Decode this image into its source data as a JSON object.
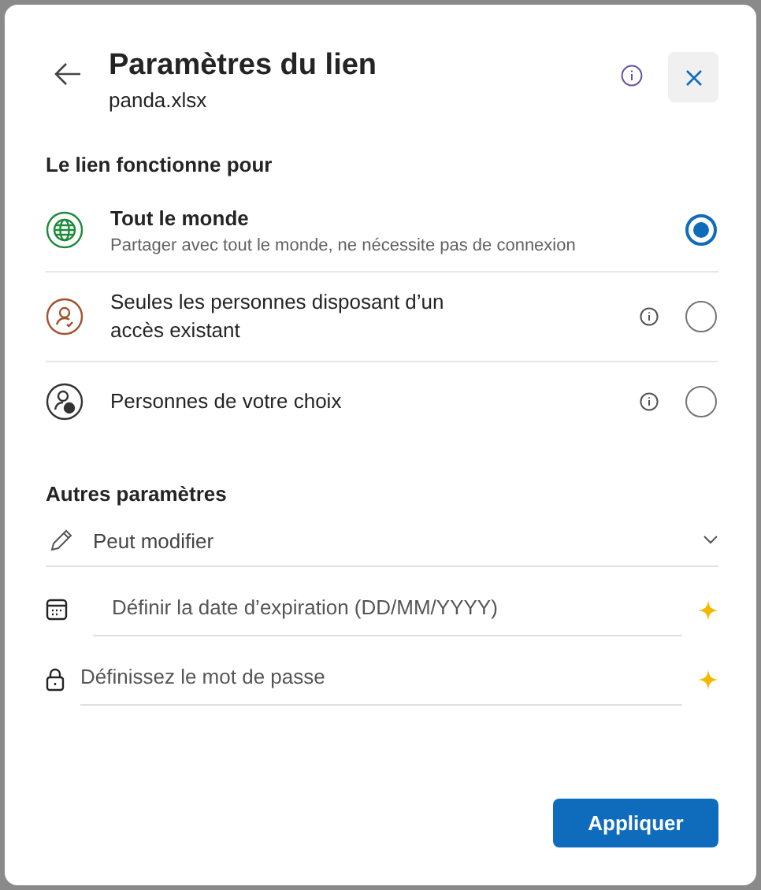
{
  "dialog": {
    "title": "Paramètres du lien",
    "subtitle": "panda.xlsx"
  },
  "section_title": "Le lien fonctionne pour",
  "options": [
    {
      "label": "Tout le monde",
      "description": "Partager avec tout le monde, ne nécessite pas de connexion",
      "info": false,
      "selected": true
    },
    {
      "label": "Seules les personnes disposant d’un accès existant",
      "info": true,
      "selected": false
    },
    {
      "label": "Personnes de votre choix",
      "info": true,
      "selected": false
    }
  ],
  "other_title": "Autres paramètres",
  "settings": [
    {
      "kind": "dropdown",
      "value": "Peut modifier"
    },
    {
      "kind": "date",
      "placeholder": "Définir la date d’expiration (DD/MM/YYYY)"
    },
    {
      "kind": "password",
      "placeholder": "Définissez le mot de passe"
    }
  ],
  "apply_button": "Appliquer"
}
